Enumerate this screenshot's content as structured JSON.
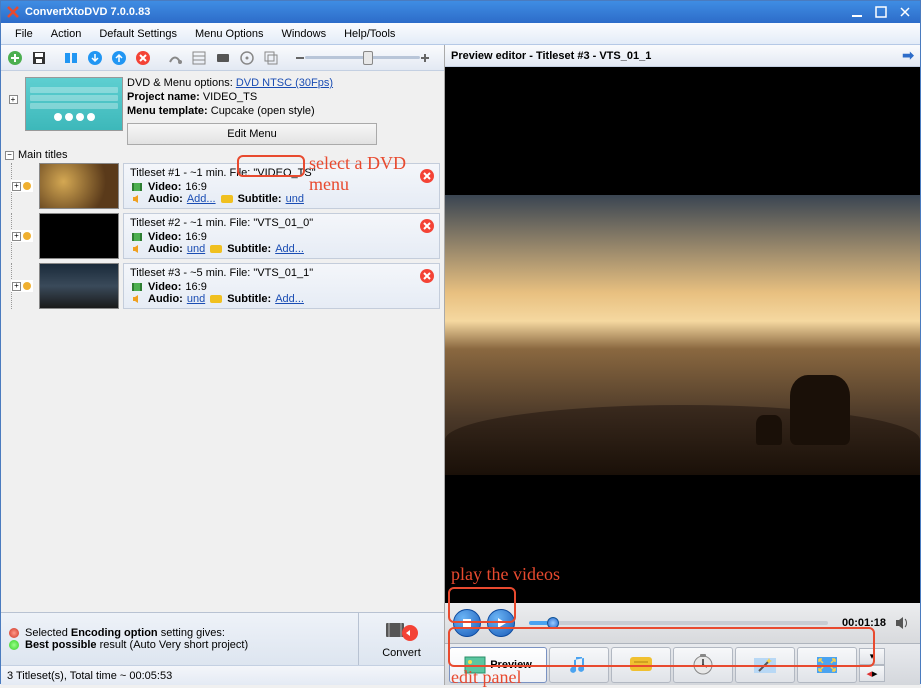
{
  "window": {
    "title": "ConvertXtoDVD 7.0.0.83"
  },
  "menubar": [
    "File",
    "Action",
    "Default Settings",
    "Menu Options",
    "Windows",
    "Help/Tools"
  ],
  "project": {
    "options_label": "DVD & Menu options:",
    "options_link": "DVD NTSC (30Fps)",
    "name_label": "Project name:",
    "name_value": "VIDEO_TS",
    "template_label": "Menu template:",
    "template_value": "Cupcake (open style)",
    "edit_menu_btn": "Edit Menu"
  },
  "annotations": {
    "select_menu": "select a DVD menu",
    "play_videos": "play the videos",
    "edit_panel": "edit panel"
  },
  "main_titles_label": "Main titles",
  "titlesets": [
    {
      "header": "Titleset #1 - ~1 min. File: \"VIDEO_TS\"",
      "video_label": "Video:",
      "video_val": "16:9",
      "audio_label": "Audio:",
      "audio_link": "Add...",
      "subtitle_label": "Subtitle:",
      "subtitle_link": "und"
    },
    {
      "header": "Titleset #2 - ~1 min. File: \"VTS_01_0\"",
      "video_label": "Video:",
      "video_val": "16:9",
      "audio_label": "Audio:",
      "audio_link": "und",
      "subtitle_label": "Subtitle:",
      "subtitle_link": "Add..."
    },
    {
      "header": "Titleset #3 - ~5 min. File: \"VTS_01_1\"",
      "video_label": "Video:",
      "video_val": "16:9",
      "audio_label": "Audio:",
      "audio_link": "und",
      "subtitle_label": "Subtitle:",
      "subtitle_link": "Add..."
    }
  ],
  "encoding": {
    "line1a": "Selected ",
    "line1b": "Encoding option",
    "line1c": " setting gives:",
    "line2a": "Best possible",
    "line2b": " result (Auto Very short project)"
  },
  "convert_label": "Convert",
  "status": "3 Titleset(s), Total time ~ 00:05:53",
  "preview": {
    "header": "Preview editor - Titleset #3 - VTS_01_1",
    "time": "00:01:18",
    "tab_preview": "Preview"
  }
}
